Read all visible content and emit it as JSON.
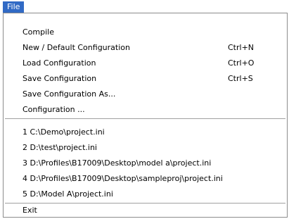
{
  "menubar": {
    "file_label": "File"
  },
  "menu": {
    "compile": {
      "label": "Compile",
      "shortcut": ""
    },
    "new_default": {
      "label": "New / Default Configuration",
      "shortcut": "Ctrl+N"
    },
    "load": {
      "label": "Load Configuration",
      "shortcut": "Ctrl+O"
    },
    "save": {
      "label": "Save Configuration",
      "shortcut": "Ctrl+S"
    },
    "save_as": {
      "label": "Save Configuration As...",
      "shortcut": ""
    },
    "configuration": {
      "label": "Configuration ...",
      "shortcut": ""
    },
    "recent_files": [
      "1 C:\\Demo\\project.ini",
      "2 D:\\test\\project.ini",
      "3 D:\\Profiles\\B17009\\Desktop\\model a\\project.ini",
      "4 D:\\Profiles\\B17009\\Desktop\\sampleproj\\project.ini",
      "5 D:\\Model A\\project.ini"
    ],
    "exit": {
      "label": "Exit"
    }
  },
  "colors": {
    "highlight": "#316ac5",
    "separator": "#a0a0a0",
    "border": "#8c8c8c"
  }
}
